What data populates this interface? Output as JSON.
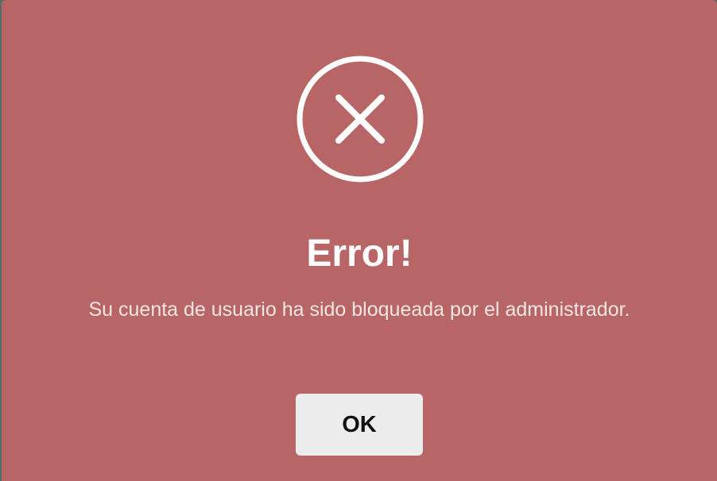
{
  "dialog": {
    "icon": "error-x-circle-icon",
    "title": "Error!",
    "message": "Su cuenta de usuario ha sido bloqueada por el administrador.",
    "ok_label": "OK"
  },
  "colors": {
    "dialog_background": "#b86565",
    "icon_and_title": "#ffffff",
    "message_text": "#f4e6e6",
    "button_background": "#ececec",
    "button_text": "#111111",
    "backdrop": "#5c6b6b"
  }
}
